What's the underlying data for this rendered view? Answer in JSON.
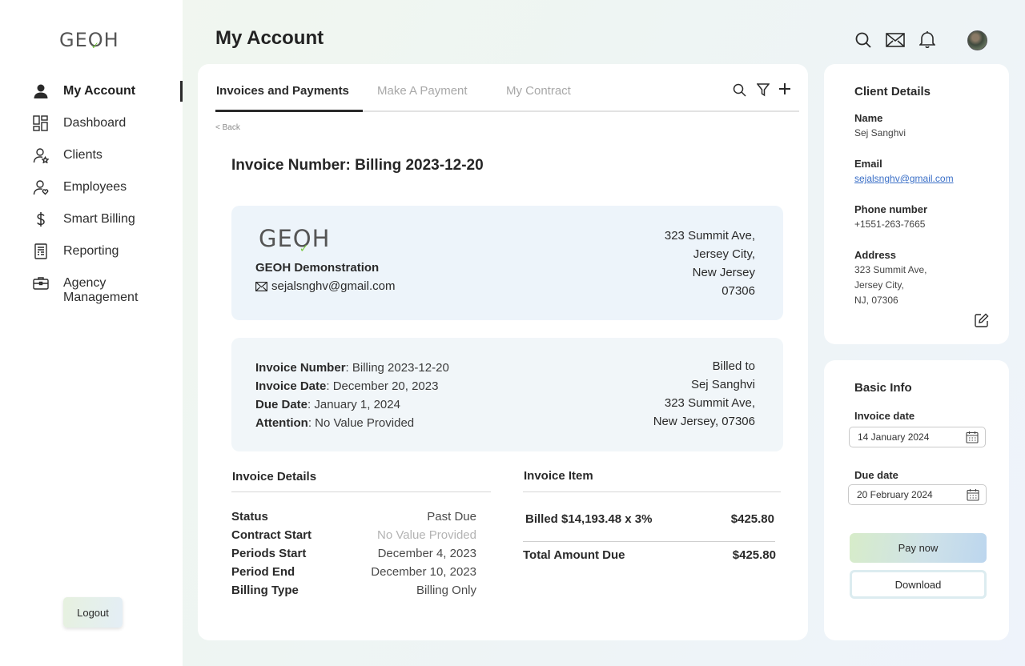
{
  "brand": {
    "logo_text_pre": "GE",
    "logo_text_o": "O",
    "logo_text_post": "H"
  },
  "sidebar": {
    "items": [
      {
        "label": "My Account",
        "icon": "user-icon",
        "active": true
      },
      {
        "label": "Dashboard",
        "icon": "dashboard-icon"
      },
      {
        "label": "Clients",
        "icon": "clients-icon"
      },
      {
        "label": "Employees",
        "icon": "employees-icon"
      },
      {
        "label": "Smart Billing",
        "icon": "dollar-icon"
      },
      {
        "label": "Reporting",
        "icon": "report-icon"
      },
      {
        "label": "Agency Management",
        "icon": "briefcase-icon"
      }
    ],
    "logout_label": "Logout"
  },
  "header": {
    "title": "My Account",
    "icons": [
      "search-icon",
      "mail-icon",
      "bell-icon",
      "avatar"
    ]
  },
  "tabs": {
    "items": [
      "Invoices and Payments",
      "Make A Payment",
      "My Contract"
    ],
    "active_index": 0,
    "tools": [
      "search-icon",
      "filter-icon",
      "plus-icon"
    ]
  },
  "invoice": {
    "back_label": "< Back",
    "title": "Invoice Number: Billing 2023-12-20",
    "company": {
      "name": "GEOH Demonstration",
      "email": "sejalsnghv@gmail.com",
      "address": [
        "323 Summit Ave,",
        "Jersey City,",
        "New Jersey",
        "07306"
      ]
    },
    "meta": {
      "number_label": "Invoice Number",
      "number_value": ": Billing 2023-12-20",
      "date_label": "Invoice Date",
      "date_value": ": December 20, 2023",
      "due_label": "Due Date",
      "due_value": ": January 1, 2024",
      "attention_label": "Attention",
      "attention_value": ": No Value Provided"
    },
    "billed_to": [
      "Billed to",
      "Sej Sanghvi",
      "323 Summit Ave,",
      "New Jersey, 07306"
    ],
    "details": {
      "title": "Invoice Details",
      "rows": [
        {
          "key": "Status",
          "value": "Past Due"
        },
        {
          "key": "Contract Start",
          "value": "No Value Provided"
        },
        {
          "key": "Periods Start",
          "value": "December 4, 2023"
        },
        {
          "key": "Period End",
          "value": "December 10, 2023"
        },
        {
          "key": "Billing Type",
          "value": "Billing Only"
        }
      ]
    },
    "item": {
      "title": "Invoice Item",
      "line_label": "Billed $14,193.48 x 3%",
      "line_amount": "$425.80",
      "total_label": "Total Amount Due",
      "total_amount": "$425.80"
    }
  },
  "client": {
    "title": "Client Details",
    "name_label": "Name",
    "name": "Sej Sanghvi",
    "email_label": "Email",
    "email": "sejalsnghv@gmail.com",
    "phone_label": "Phone number",
    "phone": "+1551-263-7665",
    "address_label": "Address",
    "address": [
      "323 Summit Ave,",
      "Jersey City,",
      "NJ, 07306"
    ]
  },
  "basic": {
    "title": "Basic Info",
    "invoice_date_label": "Invoice date",
    "invoice_date": "14 January 2024",
    "due_date_label": "Due date",
    "due_date": "20 February 2024",
    "pay_label": "Pay now",
    "download_label": "Download"
  },
  "colors": {
    "accent_green": "#7ac943",
    "link": "#3a6fc7",
    "panel_bg": "#edf4fa"
  }
}
